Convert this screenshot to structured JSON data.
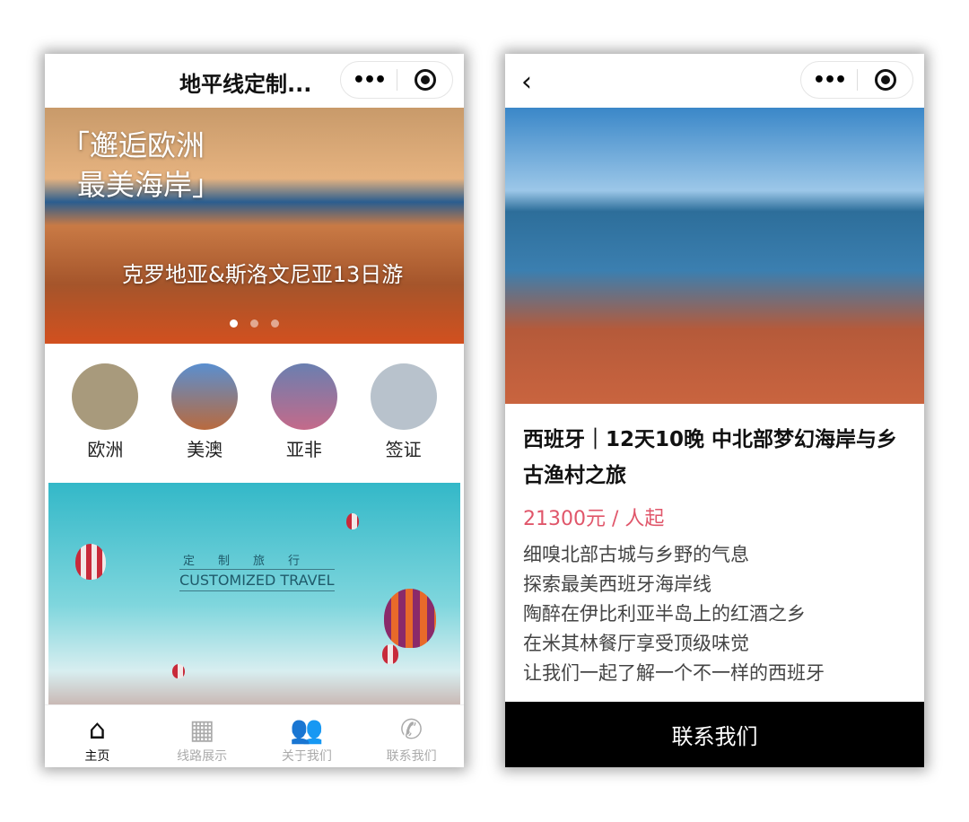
{
  "left": {
    "header": {
      "title": "地平线定制...",
      "more": "•••"
    },
    "banner": {
      "headline_line1": "「邂逅欧洲",
      "headline_line2": "最美海岸」",
      "subtitle": "克罗地亚&斯洛文尼亚13日游",
      "slides": 3,
      "active_slide": 1
    },
    "categories": [
      {
        "label": "欧洲",
        "color": "#a89a7c"
      },
      {
        "label": "美澳",
        "color": "#b96a3e"
      },
      {
        "label": "亚非",
        "color": "#6a7fb0"
      },
      {
        "label": "签证",
        "color": "#9aa7b5"
      }
    ],
    "promo": {
      "cn": "定制旅行",
      "en": "CUSTOMIZED TRAVEL"
    },
    "tabs": [
      {
        "label": "主页",
        "icon": "home-icon",
        "active": true
      },
      {
        "label": "线路展示",
        "icon": "grid-icon"
      },
      {
        "label": "关于我们",
        "icon": "users-icon"
      },
      {
        "label": "联系我们",
        "icon": "phone-icon"
      }
    ]
  },
  "right": {
    "header": {
      "more": "•••"
    },
    "title": "西班牙｜12天10晚 中北部梦幻海岸与乡古渔村之旅",
    "price": "21300元 / 人起",
    "desc": [
      "细嗅北部古城与乡野的气息",
      "探索最美西班牙海岸线",
      "陶醉在伊比利亚半岛上的红酒之乡",
      "在米其林餐厅享受顶级味觉",
      "让我们一起了解一个不一样的西班牙"
    ],
    "contact": "联系我们"
  }
}
